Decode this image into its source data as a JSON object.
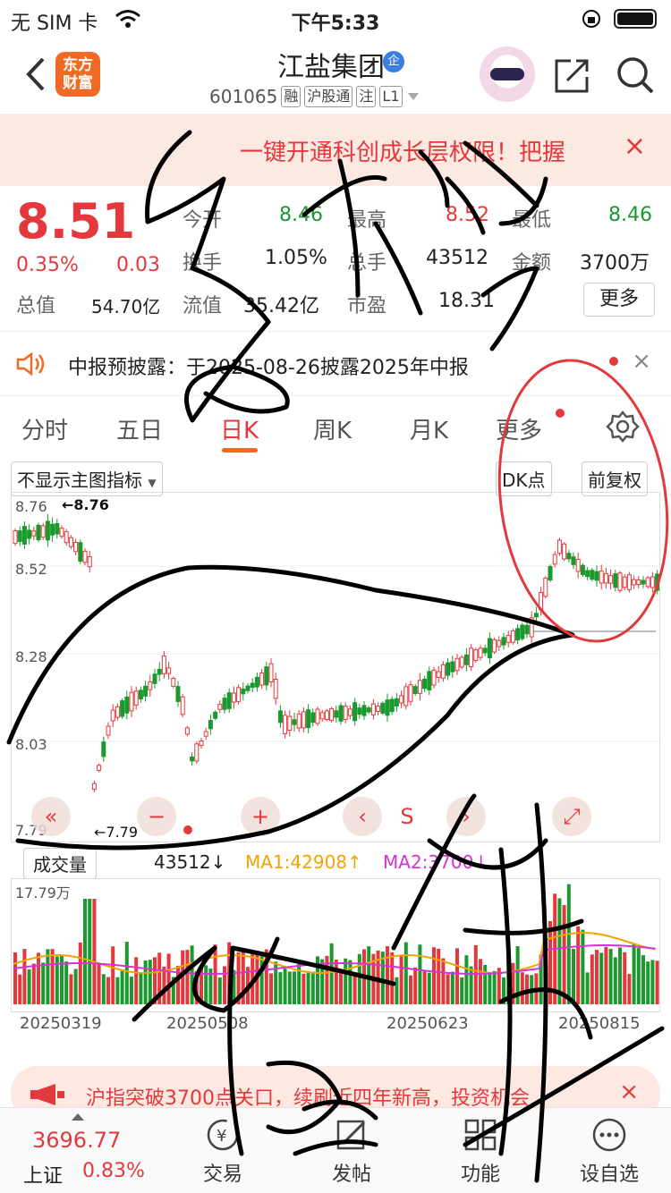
{
  "status_bar": {
    "carrier": "无 SIM 卡",
    "time": "下午5:33"
  },
  "header": {
    "logo_line1": "东方",
    "logo_line2": "财富",
    "stock_name": "江盐集团",
    "badge": "企",
    "code": "601065",
    "tags": [
      "融",
      "沪股通",
      "注",
      "L1"
    ]
  },
  "promo": {
    "text": "一键开通科创成长层权限！把握",
    "close": "×"
  },
  "quote": {
    "price": "8.51",
    "pct": "0.35%",
    "chg": "0.03",
    "open_label": "今开",
    "open": "8.46",
    "high_label": "最高",
    "high": "8.52",
    "low_label": "最低",
    "low": "8.46",
    "turnover_label": "换手",
    "turnover": "1.05%",
    "volume_label": "总手",
    "volume": "43512",
    "amount_label": "金额",
    "amount": "3700万",
    "mcap_label": "总值",
    "mcap": "54.70亿",
    "float_label": "流值",
    "float": "35.42亿",
    "pe_label": "市盈",
    "pe": "18.31",
    "more": "更多"
  },
  "notice": {
    "text": "中报预披露：于2025-08-26披露2025年中报",
    "close": "×"
  },
  "tabs": [
    "分时",
    "五日",
    "日K",
    "周K",
    "月K",
    "更多"
  ],
  "active_tab": "日K",
  "chart_toolbar": {
    "indicator": "不显示主图指标",
    "dk": "DK点",
    "adjust": "前复权"
  },
  "chart_controls": {
    "minus": "−",
    "plus": "+",
    "sell": "S"
  },
  "chart_data": {
    "type": "candlestick",
    "y_ticks": [
      "8.76",
      "8.52",
      "8.28",
      "8.03",
      "7.79"
    ],
    "max_label": "8.76",
    "min_label": "7.79",
    "ylim": [
      7.79,
      8.76
    ],
    "dates": [
      "20250319",
      "20250508",
      "20250623",
      "20250815"
    ],
    "colors": {
      "up": "#e4393c",
      "down": "#1a9a2e",
      "ma1": "#f0a500",
      "ma2": "#d633d6"
    }
  },
  "volume_panel": {
    "selector": "成交量",
    "value": "43512↓",
    "ma1": "MA1:42908↑",
    "ma2": "MA2:3700↓",
    "max_label": "17.79万"
  },
  "ticker": {
    "text": "沪指突破3700点关口，续刷近四年新高，投资机会",
    "close": "×"
  },
  "bottom_bar": {
    "index_value": "3696.77",
    "index_name": "上证",
    "index_pct": "0.83%",
    "items": [
      "交易",
      "发帖",
      "功能",
      "设自选"
    ]
  },
  "handwriting": {
    "top": "多形态",
    "bottom": "向上涨"
  }
}
